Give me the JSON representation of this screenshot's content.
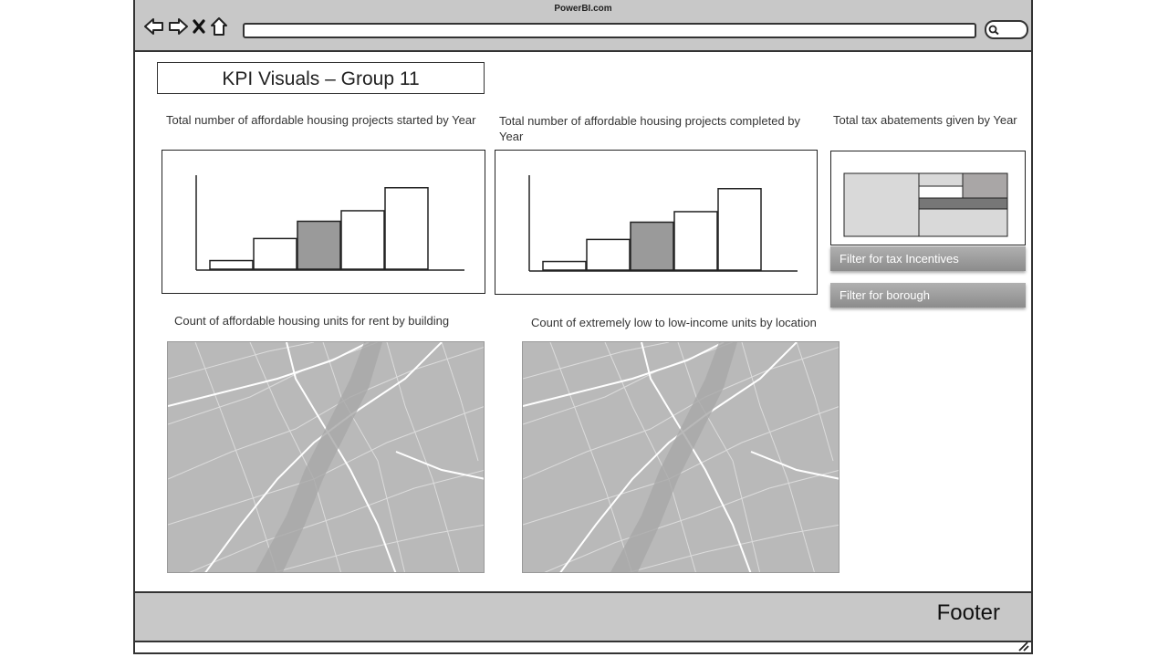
{
  "browser": {
    "site_title": "PowerBI.com",
    "nav_icons": [
      "back-arrow-icon",
      "forward-arrow-icon",
      "close-icon",
      "home-icon"
    ],
    "url_value": "",
    "search_icon": "search-icon"
  },
  "page": {
    "title": "KPI Visuals – Group 11"
  },
  "visuals": {
    "started": {
      "title": "Total number of affordable housing projects started by Year",
      "chart_type": "bar",
      "highlight_color": "#9a9a9a"
    },
    "completed": {
      "title": "Total number of affordable housing projects completed by Year",
      "chart_type": "bar",
      "highlight_color": "#9a9a9a"
    },
    "tax": {
      "title": "Total tax abatements given by Year",
      "chart_type": "treemap"
    },
    "rent_map": {
      "title": "Count of affordable housing units for rent by building"
    },
    "income_map": {
      "title": "Count of extremely low to low-income units by location"
    }
  },
  "filters": {
    "tax_label": "Filter for tax Incentives",
    "borough_label": "Filter for borough"
  },
  "footer": {
    "label": "Footer"
  },
  "chart_data": [
    {
      "type": "bar",
      "title": "Total number of affordable housing projects started by Year",
      "categories": [
        "",
        "",
        "",
        "",
        ""
      ],
      "values": [
        9,
        32,
        50,
        61,
        85
      ],
      "highlight_index": 2,
      "ylim": [
        0,
        100
      ],
      "grid": false
    },
    {
      "type": "bar",
      "title": "Total number of affordable housing projects completed by Year",
      "categories": [
        "",
        "",
        "",
        "",
        ""
      ],
      "values": [
        9,
        32,
        50,
        61,
        85
      ],
      "highlight_index": 2,
      "ylim": [
        0,
        100
      ],
      "grid": false
    }
  ]
}
